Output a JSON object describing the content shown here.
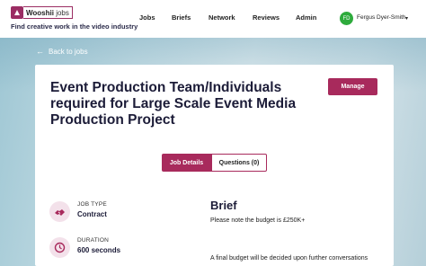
{
  "header": {
    "logo_brand": "Wooshii",
    "logo_suffix": "jobs",
    "tagline": "Find creative work in the video industry",
    "nav": [
      "Jobs",
      "Briefs",
      "Network",
      "Reviews",
      "Admin"
    ],
    "user_initials": "FD",
    "user_name": "Fergus Dyer-Smith"
  },
  "back_link": "Back to jobs",
  "job": {
    "title": "Event Production Team/Individuals required for Large Scale Event Media Production Project",
    "manage_label": "Manage"
  },
  "tabs": [
    {
      "label": "Job Details",
      "active": true
    },
    {
      "label": "Questions (0)",
      "active": false
    }
  ],
  "details": [
    {
      "label": "JOB TYPE",
      "value": "Contract",
      "icon": "handshake-icon"
    },
    {
      "label": "DURATION",
      "value": "600 seconds",
      "icon": "clock-icon"
    }
  ],
  "brief": {
    "heading": "Brief",
    "line1": "Please note the budget is £250K+",
    "line2": "A final budget will be decided upon further conversations"
  },
  "colors": {
    "accent": "#a82a5c",
    "avatar": "#2eab3c",
    "icon_bg": "#f3e1ea",
    "title": "#1c1c38"
  }
}
